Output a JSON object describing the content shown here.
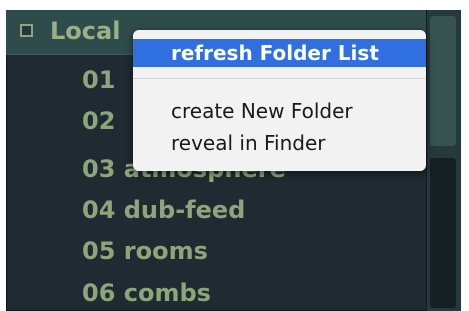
{
  "browser": {
    "header": {
      "label": "Local"
    },
    "folders": [
      {
        "label": "01"
      },
      {
        "label": "02"
      },
      {
        "label": "03 atmosphere"
      },
      {
        "label": "04 dub-feed"
      },
      {
        "label": "05 rooms"
      },
      {
        "label": "06 combs"
      }
    ]
  },
  "context_menu": {
    "items": [
      {
        "label": "refresh Folder List"
      },
      {
        "label": "create New Folder"
      },
      {
        "label": "reveal in Finder"
      }
    ]
  },
  "colors": {
    "panel_bg": "#1f2a32",
    "header_bg": "#2f4c4c",
    "text_green": "#8ea57a",
    "menu_bg": "#f2f2f2",
    "menu_highlight": "#2f6fe0"
  }
}
